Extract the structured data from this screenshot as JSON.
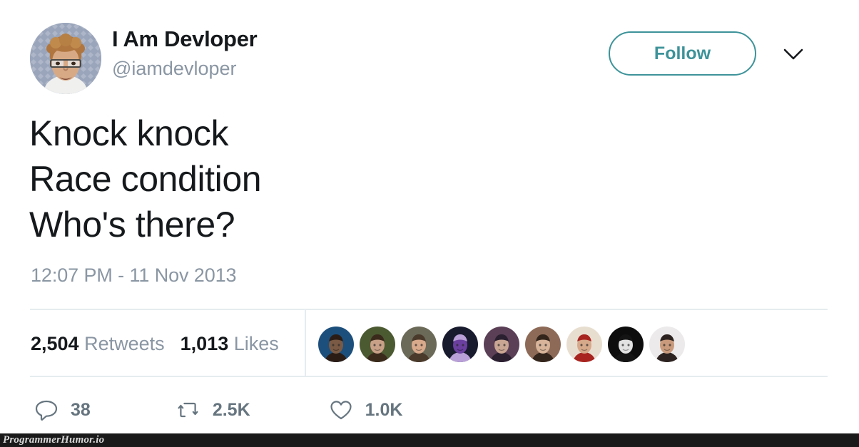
{
  "tweet": {
    "display_name": "I Am Devloper",
    "handle": "@iamdevloper",
    "avatar_icon": "profile-photo-napoleon",
    "follow_label": "Follow",
    "caret_icon": "chevron-down-icon",
    "text": "Knock knock\nRace condition\nWho's there?",
    "timestamp": "12:07 PM - 11 Nov 2013",
    "stats": {
      "retweets_count": "2,504",
      "retweets_label": "Retweets",
      "likes_count": "1,013",
      "likes_label": "Likes"
    },
    "liker_faces": [
      {
        "name": "liker-avatar-1",
        "bg": "#1d4f7c",
        "skin": "#7a5a44",
        "hair": "#2b1d16"
      },
      {
        "name": "liker-avatar-2",
        "bg": "#4c5a32",
        "skin": "#c8a088",
        "hair": "#3a2a1c"
      },
      {
        "name": "liker-avatar-3",
        "bg": "#6b6a58",
        "skin": "#d9a98c",
        "hair": "#4a3a2c"
      },
      {
        "name": "liker-avatar-4",
        "bg": "#181a2e",
        "skin": "#6b3fa0",
        "hair": "#b9a0d8"
      },
      {
        "name": "liker-avatar-5",
        "bg": "#5a3f56",
        "skin": "#c9a693",
        "hair": "#2a2030"
      },
      {
        "name": "liker-avatar-6",
        "bg": "#8d6a57",
        "skin": "#d7b49a",
        "hair": "#33251c"
      },
      {
        "name": "liker-avatar-7",
        "bg": "#e8ded0",
        "skin": "#d6a98a",
        "hair": "#a8241f"
      },
      {
        "name": "liker-avatar-8",
        "bg": "#0d0d0d",
        "skin": "#e2e2e2",
        "hair": "#141414"
      },
      {
        "name": "liker-avatar-9",
        "bg": "#eceaea",
        "skin": "#c99a7c",
        "hair": "#2c2320"
      }
    ],
    "actions": [
      {
        "name": "reply",
        "icon": "speech-bubble-icon",
        "count": "38"
      },
      {
        "name": "retweet",
        "icon": "retweet-icon",
        "count": "2.5K"
      },
      {
        "name": "like",
        "icon": "heart-icon",
        "count": "1.0K"
      }
    ]
  },
  "watermark": {
    "text": "ProgrammerHumor.io"
  },
  "colors": {
    "accent_teal": "#3d9399",
    "text_primary": "#16191c",
    "text_muted": "#8a96a3",
    "action_gray": "#66757f",
    "divider": "#e6ecf0",
    "watermark_bar": "#1a1a1a"
  }
}
